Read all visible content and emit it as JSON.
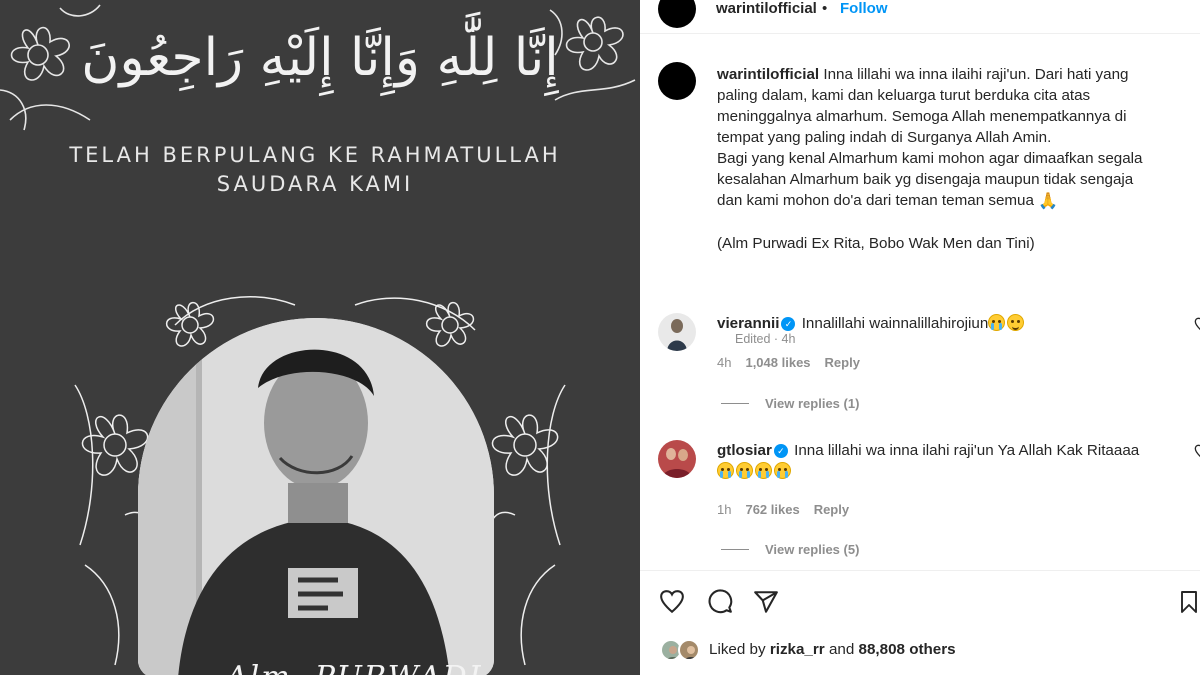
{
  "image": {
    "arabic_text": "إِنَّا لِلَّٰهِ وَإِنَّا إِلَيْهِ رَاجِعُونَ",
    "line1": "TELAH BERPULANG KE RAHMATULLAH",
    "line2": "SAUDARA KAMI",
    "name": "Alm. PURWADI"
  },
  "header": {
    "username": "warintilofficial",
    "separator": "•",
    "follow_label": "Follow"
  },
  "caption": {
    "username": "warintilofficial",
    "text_lines": [
      "Inna lillahi wa inna ilaihi raji'un. Dari hati yang",
      "paling dalam, kami dan keluarga turut berduka cita atas",
      "meninggalnya almarhum. Semoga Allah menempatkannya di",
      "tempat yang paling indah di Surganya Allah Amin.",
      "Bagi yang kenal Almarhum kami mohon agar dimaafkan segala",
      "kesalahan Almarhum baik yg disengaja maupun tidak sengaja",
      "dan kami mohon do'a dari teman teman semua"
    ],
    "names_line": "(Alm Purwadi Ex Rita, Bobo Wak Men dan Tini)",
    "edited": "Edited · 4h"
  },
  "comments": [
    {
      "username": "vierannii",
      "text": "Innalillahi wainnalillahirojiun",
      "time": "4h",
      "likes": "1,048 likes",
      "reply_label": "Reply",
      "view_replies": "View replies (1)"
    },
    {
      "username": "gtlosiar",
      "text": "Inna lillahi wa inna ilahi raji'un Ya Allah Kak Ritaaaa",
      "time": "1h",
      "likes": "762 likes",
      "reply_label": "Reply",
      "view_replies": "View replies (5)"
    }
  ],
  "likes": {
    "prefix": "Liked by",
    "user": "rizka_rr",
    "middle": "and",
    "others": "88,808 others"
  },
  "icons": [
    "heart-icon",
    "comment-icon",
    "share-icon",
    "bookmark-icon",
    "verified-icon",
    "more-icon"
  ],
  "colors": {
    "follow": "#0095f6",
    "muted": "#8e8e8e",
    "text": "#262626",
    "image_bg": "#3c3c3c"
  }
}
